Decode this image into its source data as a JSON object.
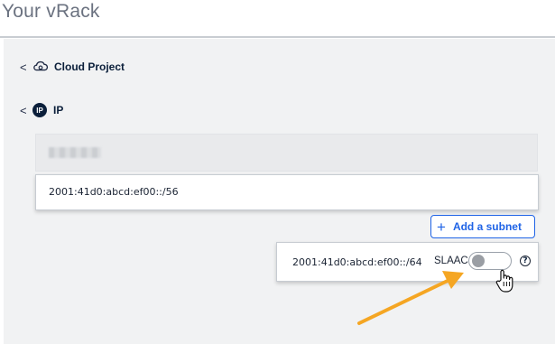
{
  "page": {
    "title": "Your vRack"
  },
  "tree": {
    "cloud_project": {
      "label": "Cloud Project",
      "chevron": "<",
      "icon": "cloud-gear-icon"
    },
    "ip": {
      "label": "IP",
      "chevron": "<",
      "icon": "ip-badge-icon",
      "badge_text": "IP"
    }
  },
  "subnets": {
    "parent_block": "2001:41d0:abcd:ef00::/56",
    "child_block": "2001:41d0:abcd:ef00::/64",
    "add_subnet_label": "Add a subnet",
    "slaac": {
      "label": "SLAAC",
      "enabled": false
    },
    "help_symbol": "?"
  },
  "colors": {
    "accent": "#1f63e6",
    "navy": "#0b1f3a",
    "arrow": "#f5a623",
    "panel_bg": "#f1f2f3"
  }
}
